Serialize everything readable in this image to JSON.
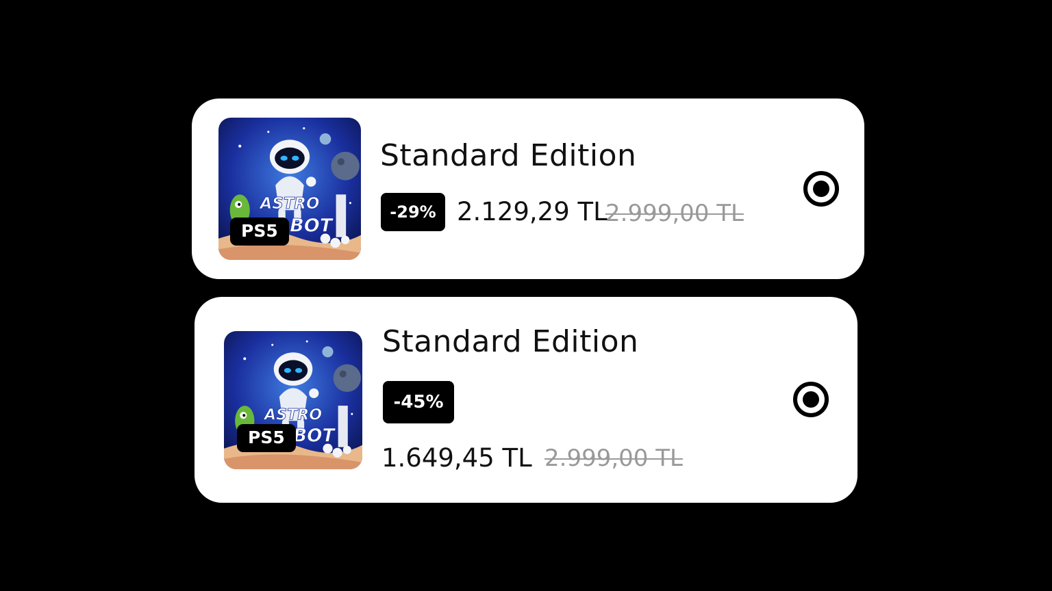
{
  "products": [
    {
      "cover_title": "ASTRO BOT",
      "platform": "PS5",
      "edition": "Standard Edition",
      "discount": "-29%",
      "price": "2.129,29 TL",
      "original_price": "2.999,00 TL",
      "selected": true
    },
    {
      "cover_title": "ASTRO BOT",
      "platform": "PS5",
      "edition": "Standard Edition",
      "discount": "-45%",
      "price": "1.649,45 TL",
      "original_price": "2.999,00 TL",
      "selected": true
    }
  ],
  "colors": {
    "background": "#000000",
    "card": "#ffffff",
    "badge": "#000000",
    "strikethrough_price": "#999999",
    "cover_sky": "#1a2f9e"
  },
  "icons": [
    "radio-selected-icon",
    "astro-bot-cover-image"
  ]
}
